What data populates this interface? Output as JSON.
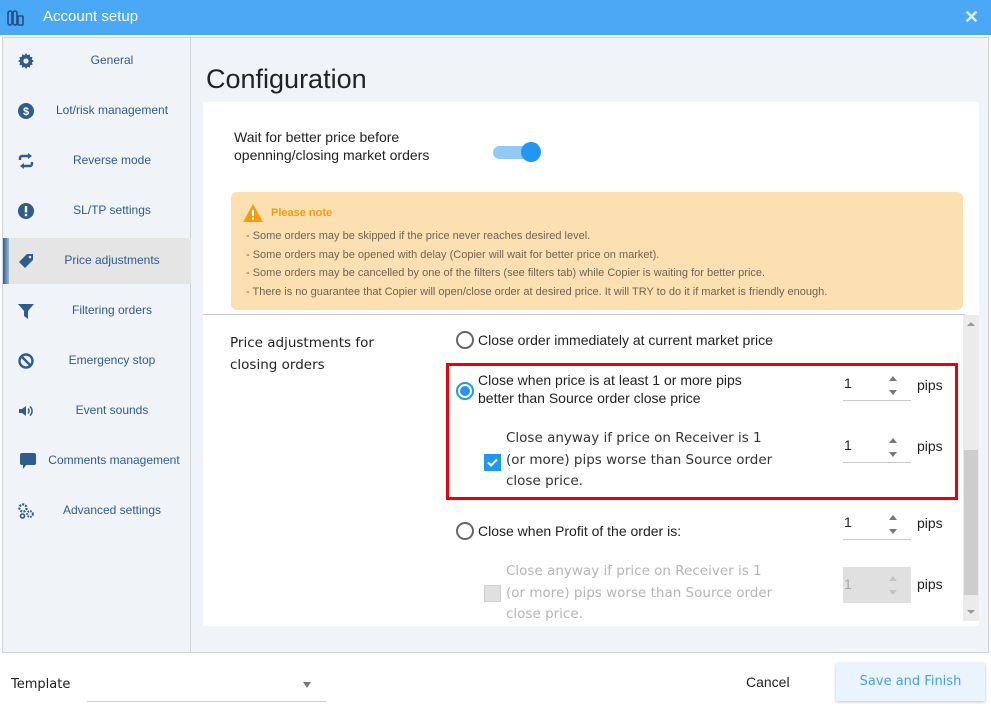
{
  "window": {
    "title": "Account setup",
    "close_glyph": "✕"
  },
  "sidebar": {
    "items": [
      {
        "label": "General",
        "icon": "gear-icon"
      },
      {
        "label": "Lot/risk management",
        "icon": "dollar-circle-icon"
      },
      {
        "label": "Reverse mode",
        "icon": "refresh-icon"
      },
      {
        "label": "SL/TP settings",
        "icon": "exclamation-circle-icon"
      },
      {
        "label": "Price adjustments",
        "icon": "tag-icon",
        "active": true
      },
      {
        "label": "Filtering orders",
        "icon": "filter-icon"
      },
      {
        "label": "Emergency stop",
        "icon": "ban-icon"
      },
      {
        "label": "Event sounds",
        "icon": "speaker-icon"
      },
      {
        "label": "Comments management",
        "icon": "comment-icon"
      },
      {
        "label": "Advanced settings",
        "icon": "cogs-icon"
      }
    ]
  },
  "main": {
    "title": "Configuration",
    "wait_option": {
      "label_line1": "Wait for better price before",
      "label_line2": "openning/closing market orders",
      "enabled": true
    },
    "note": {
      "title": "Please note",
      "lines": [
        "- Some orders may be skipped if the price never reaches desired level.",
        "- Some orders may be opened with delay (Copier will wait for better price on market).",
        "- Some orders may be cancelled by one of the filters (see filters tab) while Copier is waiting for better price.",
        "- There is no guarantee that Copier will open/close order at desired price. It will TRY to do it if market is friendly enough."
      ]
    },
    "closing_section": {
      "label_line1": "Price adjustments for",
      "label_line2": "closing orders",
      "options": [
        {
          "label": "Close order immediately at current market price",
          "selected": false
        },
        {
          "label_line1": "Close when price is at least 1 or more pips",
          "label_line2": "better than Source order close price",
          "selected": true,
          "value": "1",
          "unit": "pips",
          "fallback": {
            "line1": "Close anyway if price on Receiver is 1",
            "line2": "(or more) pips worse than Source order",
            "line3": "close price.",
            "checked": true,
            "value": "1",
            "unit": "pips"
          }
        },
        {
          "label": "Close when Profit of the order is:",
          "selected": false,
          "value": "1",
          "unit": "pips",
          "fallback": {
            "line1": "Close anyway if price on Receiver is 1",
            "line2": "(or more) pips worse than Source order",
            "line3": "close price.",
            "checked": false,
            "disabled": true,
            "value": "1",
            "unit": "pips"
          }
        }
      ]
    }
  },
  "footer": {
    "template_label": "Template",
    "template_value": "",
    "cancel_label": "Cancel",
    "save_label": "Save and Finish"
  }
}
